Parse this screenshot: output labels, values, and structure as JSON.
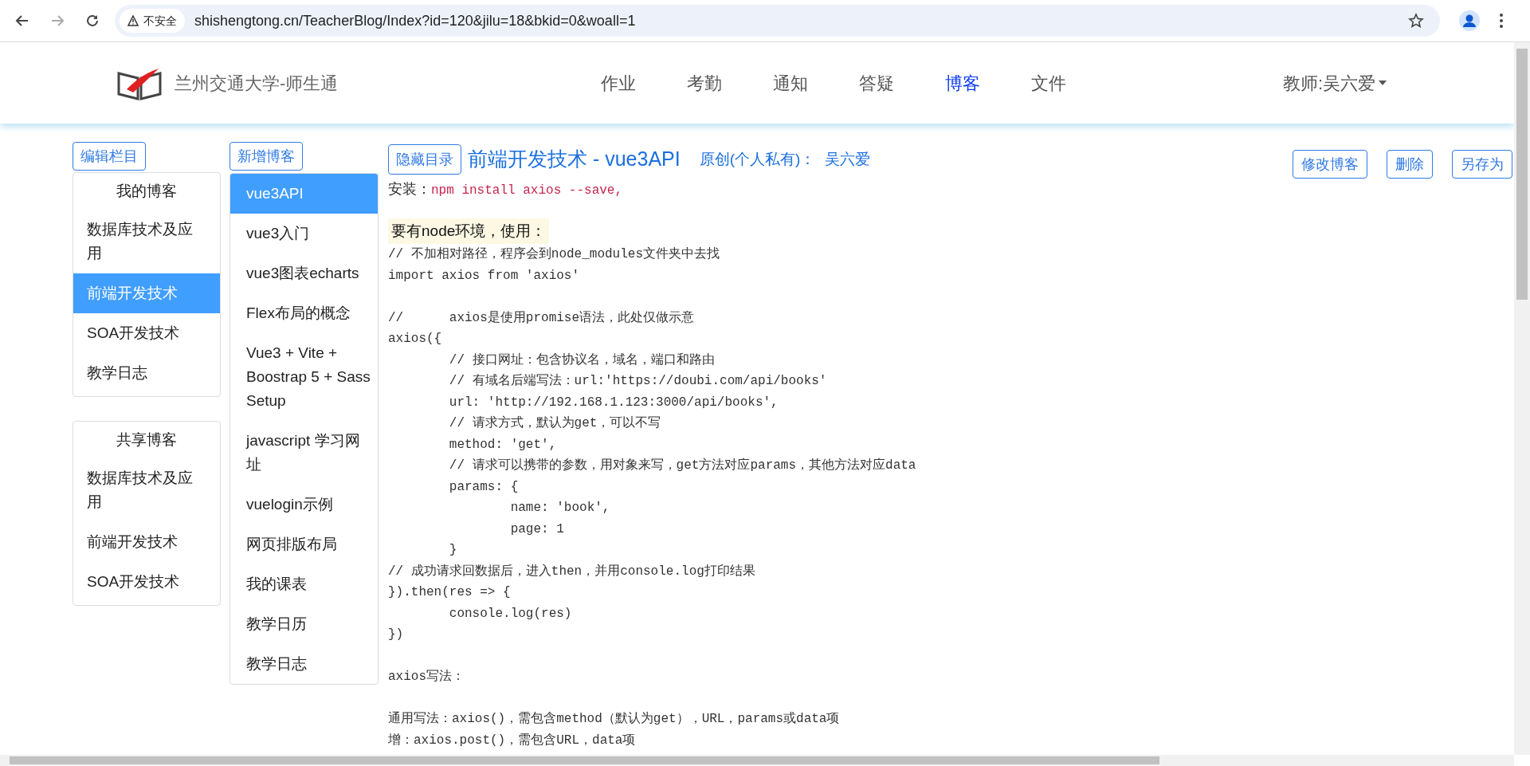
{
  "browser": {
    "security_label": "不安全",
    "url": "shishengtong.cn/TeacherBlog/Index?id=120&jilu=18&bkid=0&woall=1"
  },
  "header": {
    "brand": "兰州交通大学-师生通",
    "nav": [
      {
        "label": "作业",
        "selected": false
      },
      {
        "label": "考勤",
        "selected": false
      },
      {
        "label": "通知",
        "selected": false
      },
      {
        "label": "答疑",
        "selected": false
      },
      {
        "label": "博客",
        "selected": true
      },
      {
        "label": "文件",
        "selected": false
      }
    ],
    "user_menu": "教师:吴六爱"
  },
  "column_panel": {
    "button": "编辑栏目",
    "sections": [
      {
        "title": "我的博客",
        "items": [
          {
            "label": "数据库技术及应用",
            "selected": false
          },
          {
            "label": "前端开发技术",
            "selected": true
          },
          {
            "label": "SOA开发技术",
            "selected": false
          },
          {
            "label": "教学日志",
            "selected": false
          }
        ]
      },
      {
        "title": "共享博客",
        "items": [
          {
            "label": "数据库技术及应用",
            "selected": false
          },
          {
            "label": "前端开发技术",
            "selected": false
          },
          {
            "label": "SOA开发技术",
            "selected": false
          }
        ]
      }
    ]
  },
  "blog_list": {
    "button": "新增博客",
    "items": [
      {
        "label": "vue3API",
        "selected": true
      },
      {
        "label": "vue3入门",
        "selected": false
      },
      {
        "label": "vue3图表echarts",
        "selected": false
      },
      {
        "label": "Flex布局的概念",
        "selected": false
      },
      {
        "label": "Vue3 + Vite + Boostrap 5 + Sass Setup",
        "selected": false
      },
      {
        "label": "javascript 学习网址",
        "selected": false
      },
      {
        "label": "vuelogin示例",
        "selected": false
      },
      {
        "label": "网页排版布局",
        "selected": false
      },
      {
        "label": "我的课表",
        "selected": false
      },
      {
        "label": "教学日历",
        "selected": false
      },
      {
        "label": "教学日志",
        "selected": false
      }
    ]
  },
  "article": {
    "toggle_button": "隐藏目录",
    "title": "前端开发技术 - vue3API",
    "meta_label": "原创(个人私有)：",
    "author": "吴六爱",
    "actions": [
      "修改博客",
      "删除",
      "另存为"
    ],
    "body": [
      {
        "kind": "install",
        "label": "安装：",
        "code": "npm install axios --save,"
      },
      {
        "kind": "highlight",
        "text": "要有node环境，使用："
      },
      {
        "kind": "code",
        "lines": [
          "// 不加相对路径，程序会到node_modules文件夹中去找",
          "import axios from 'axios'"
        ]
      },
      {
        "kind": "code",
        "lines": [
          "//\taxios是使用promise语法，此处仅做示意",
          "axios({",
          "\t// 接口网址：包含协议名，域名，端口和路由",
          "\t// 有域名后端写法：url:'https://doubi.com/api/books'",
          "\turl: 'http://192.168.1.123:3000/api/books',",
          "\t// 请求方式，默认为get，可以不写",
          "\tmethod: 'get',",
          "\t// 请求可以携带的参数，用对象来写，get方法对应params，其他方法对应data",
          "\tparams: {",
          "\t\tname: 'book',",
          "\t\tpage: 1",
          "\t}",
          "// 成功请求回数据后，进入then，并用console.log打印结果",
          "}).then(res => {",
          "\tconsole.log(res)",
          "})"
        ]
      },
      {
        "kind": "code",
        "lines": [
          "axios写法："
        ]
      },
      {
        "kind": "code",
        "lines": [
          "通用写法：axios()，需包含method（默认为get），URL，params或data项",
          "增：axios.post()，需包含URL，data项"
        ]
      }
    ]
  }
}
